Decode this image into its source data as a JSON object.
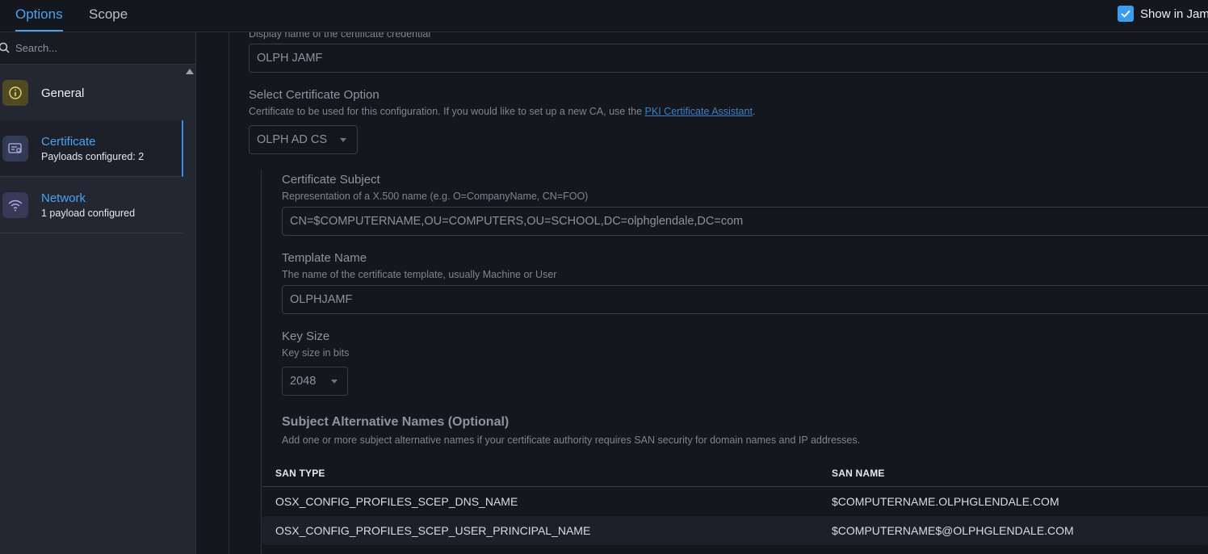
{
  "tabs": [
    {
      "label": "Options",
      "active": true
    },
    {
      "label": "Scope",
      "active": false
    }
  ],
  "show_in": {
    "label": "Show in Jam",
    "checked": true
  },
  "sidebar": {
    "search_placeholder": "Search...",
    "items": [
      {
        "title": "General",
        "subtitle": "",
        "icon": "info-icon",
        "active": false
      },
      {
        "title": "Certificate",
        "subtitle": "Payloads configured: 2",
        "icon": "certificate-icon",
        "active": true
      },
      {
        "title": "Network",
        "subtitle": "1 payload configured",
        "icon": "wifi-icon",
        "active": false
      }
    ]
  },
  "form": {
    "display_name": {
      "description": "Display name of the certificate credential",
      "value": "OLPH JAMF"
    },
    "cert_option": {
      "label": "Select Certificate Option",
      "description_prefix": "Certificate to be used for this configuration. If you would like to set up a new CA, use the ",
      "link_text": "PKI Certificate Assistant",
      "description_suffix": ".",
      "value": "OLPH AD CS"
    },
    "subject": {
      "label": "Certificate Subject",
      "description": "Representation of a X.500 name (e.g. O=CompanyName, CN=FOO)",
      "value": "CN=$COMPUTERNAME,OU=COMPUTERS,OU=SCHOOL,DC=olphglendale,DC=com"
    },
    "template": {
      "label": "Template Name",
      "description": "The name of the certificate template, usually Machine or User",
      "value": "OLPHJAMF"
    },
    "key_size": {
      "label": "Key Size",
      "description": "Key size in bits",
      "value": "2048"
    },
    "san": {
      "heading": "Subject Alternative Names (Optional)",
      "description": "Add one or more subject alternative names if your certificate authority requires SAN security for domain names and IP addresses.",
      "columns": [
        "SAN TYPE",
        "SAN NAME"
      ],
      "rows": [
        [
          "OSX_CONFIG_PROFILES_SCEP_DNS_NAME",
          "$COMPUTERNAME.OLPHGLENDALE.COM"
        ],
        [
          "OSX_CONFIG_PROFILES_SCEP_USER_PRINCIPAL_NAME",
          "$COMPUTERNAME$@OLPHGLENDALE.COM"
        ]
      ]
    }
  },
  "colors": {
    "accent": "#4aa3f0",
    "link": "#3b82c4",
    "general_icon_bg": "#4f4a22",
    "cert_icon_bg": "#343a56",
    "network_icon_bg": "#3a3757"
  }
}
